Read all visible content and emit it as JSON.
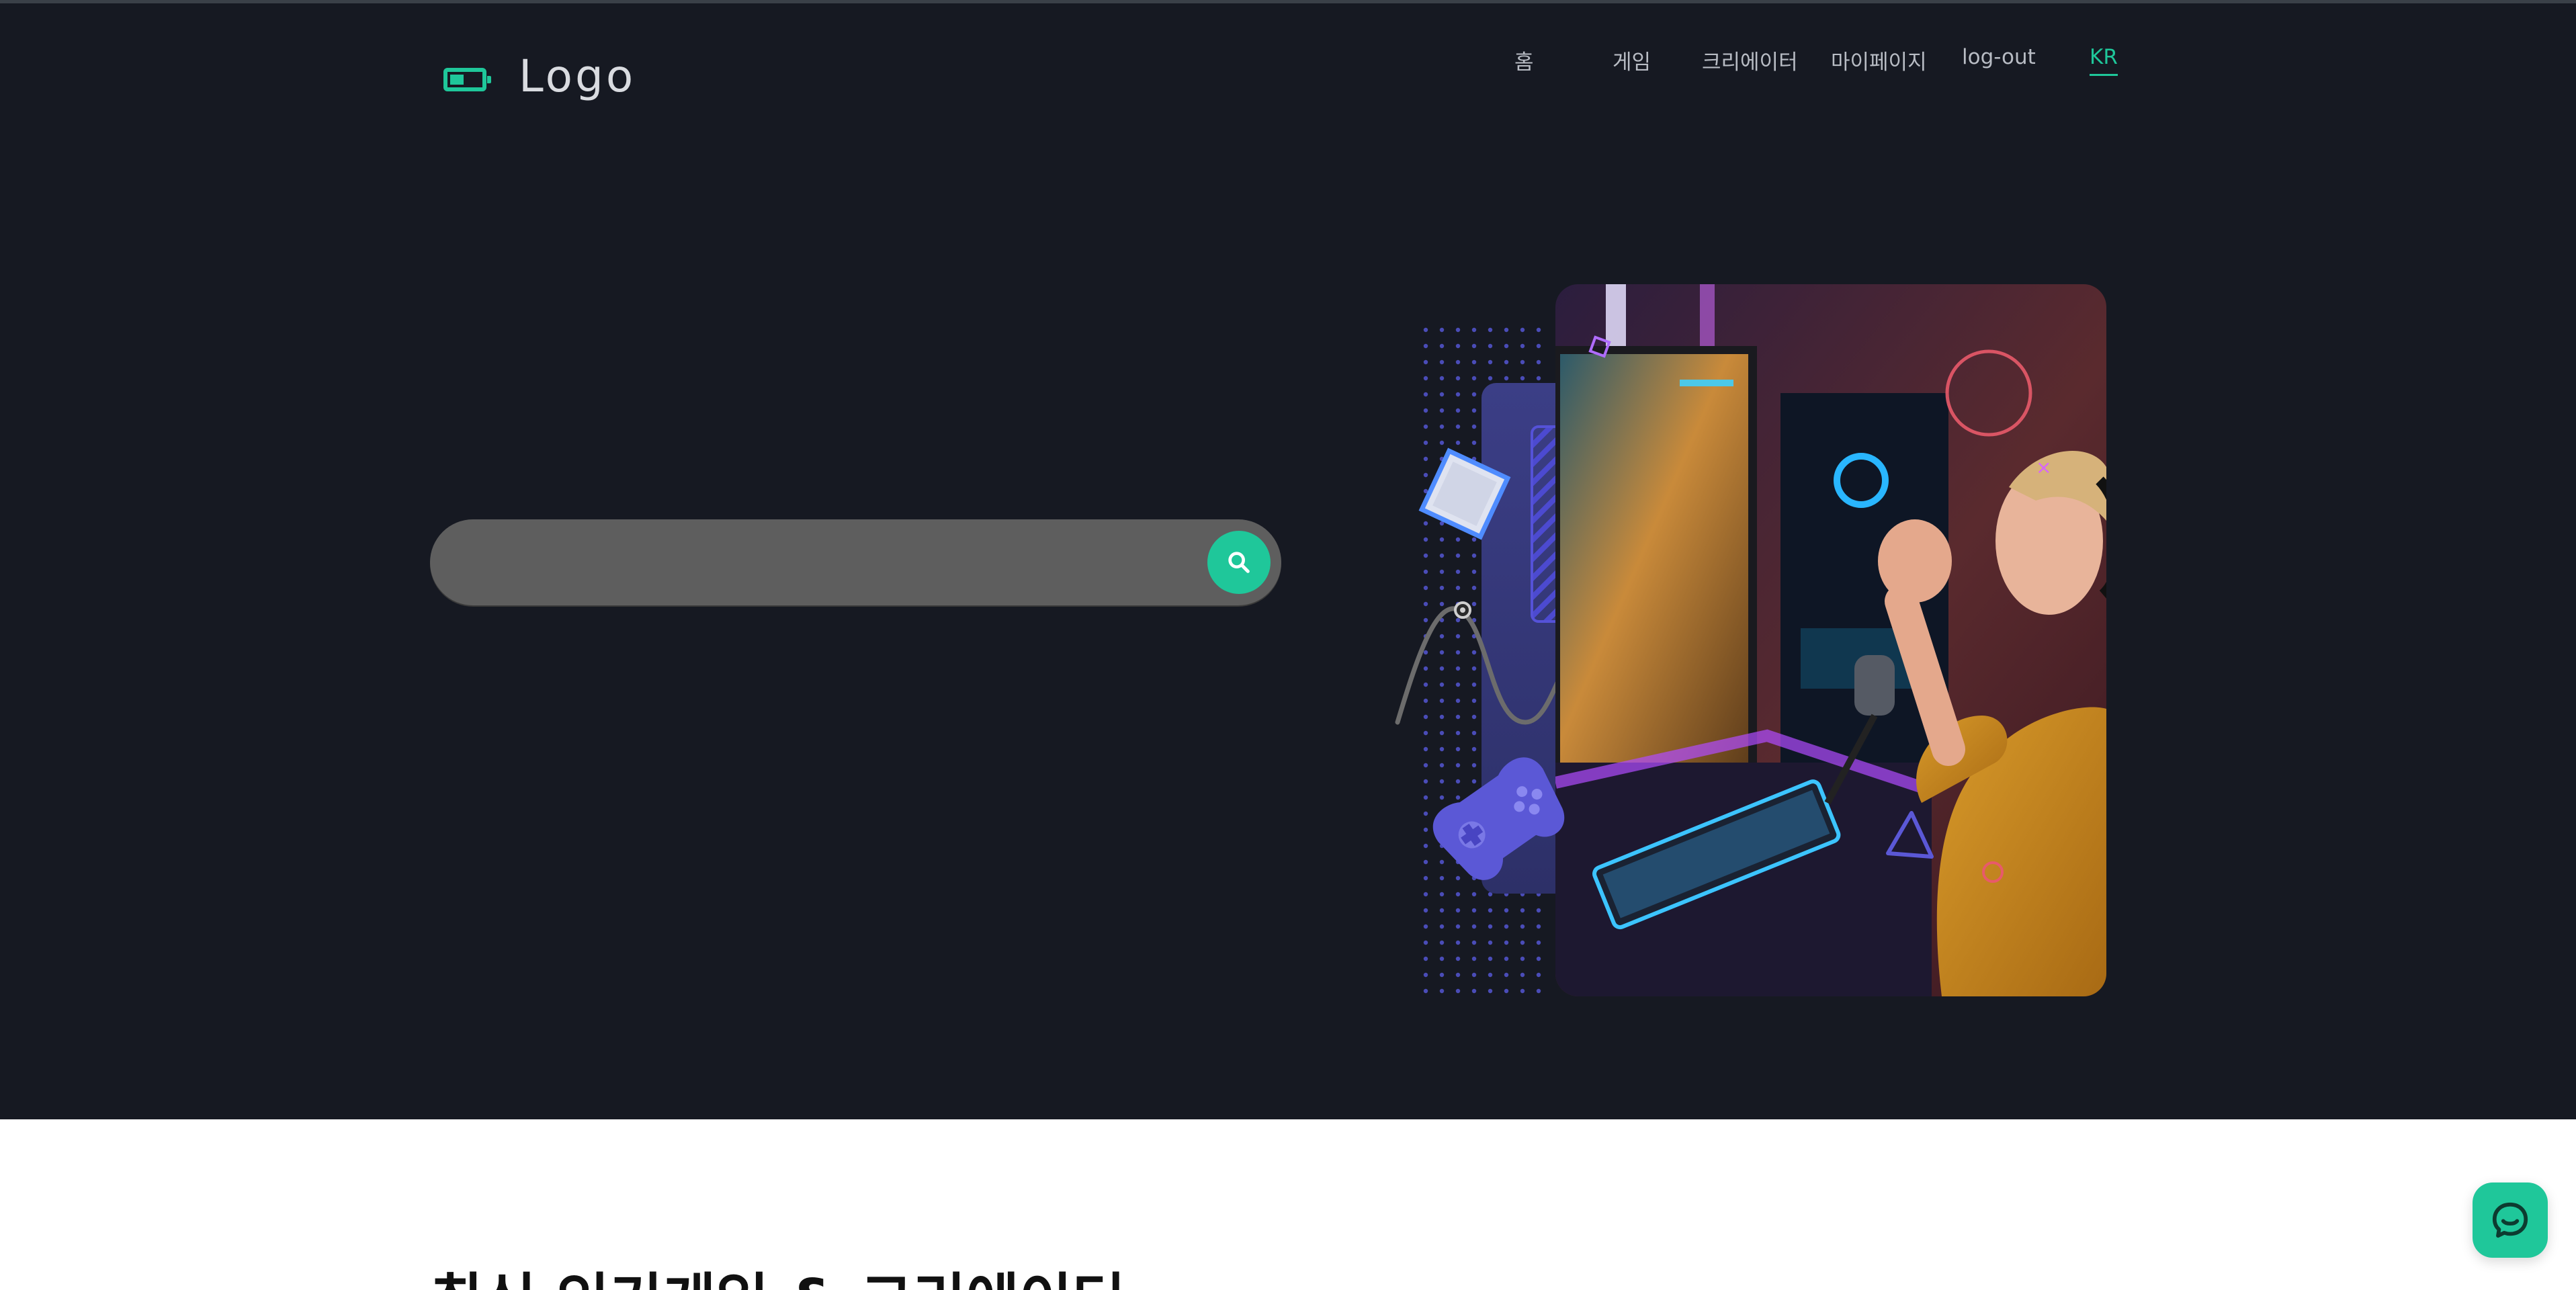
{
  "header": {
    "logo_text": "Logo",
    "nav": {
      "home": "홈",
      "game": "게임",
      "creator": "크리에이터",
      "mypage": "마이페이지",
      "logout": "log-out",
      "lang": "KR"
    }
  },
  "search": {
    "placeholder": "",
    "value": ""
  },
  "section": {
    "title": "최신 인기게임 & 크리에이터"
  },
  "icons": {
    "logo": "battery-icon",
    "search": "search-icon",
    "chat": "chat-icon"
  },
  "colors": {
    "accent": "#1fc79a",
    "hero_bg": "#161922",
    "search_bg": "#5e5e5e",
    "nav_text": "#b8bcc4",
    "illus_purple": "#5b58d6",
    "illus_pink": "#e85a6a"
  }
}
